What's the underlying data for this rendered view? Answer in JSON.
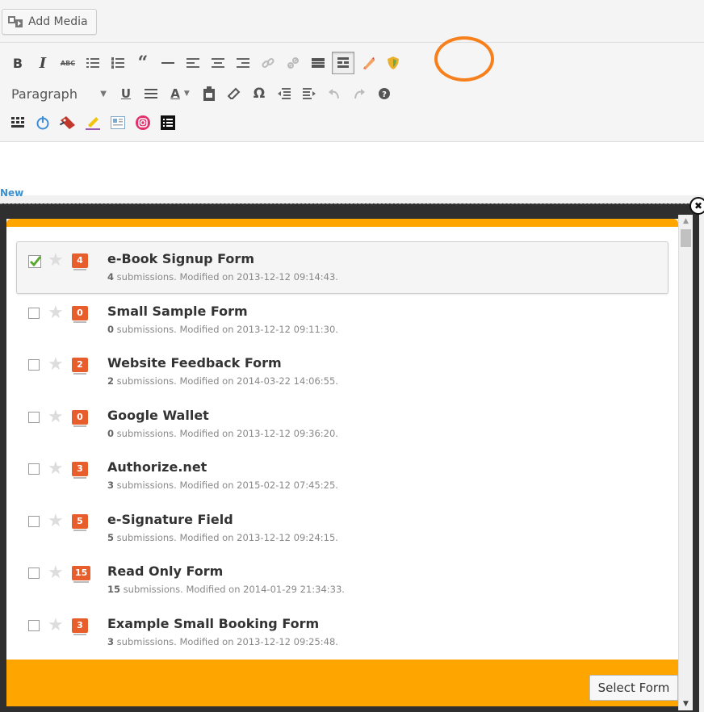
{
  "editor": {
    "add_media_label": "Add Media",
    "format_select_value": "Paragraph",
    "new_tag": "New"
  },
  "colors": {
    "accent_orange": "#ffa500",
    "highlight_ring": "#f7801c",
    "badge_red": "#e75e2c",
    "check_green": "#5aa832"
  },
  "toolbar": {
    "row1": [
      "bold-icon",
      "italic-icon",
      "strikethrough-icon",
      "bullet-list-icon",
      "numbered-list-icon",
      "blockquote-icon",
      "horizontal-rule-icon",
      "align-left-icon",
      "align-center-icon",
      "align-right-icon",
      "link-icon",
      "unlink-icon",
      "read-more-icon",
      "toolbar-toggle-icon",
      "form-pen-icon",
      "shield-icon"
    ],
    "row2": [
      "underline-icon",
      "justify-icon",
      "text-color-icon",
      "paste-text-icon",
      "clear-format-icon",
      "special-char-icon",
      "outdent-icon",
      "indent-icon",
      "undo-icon",
      "redo-icon",
      "help-icon"
    ],
    "row3": [
      "grid-icon",
      "power-icon",
      "tag-icon",
      "marker-icon",
      "image-text-icon",
      "instagram-icon",
      "list-block-icon"
    ]
  },
  "modal": {
    "select_button_label": "Select Form",
    "forms": [
      {
        "title": "e-Book Signup Form",
        "count": "4",
        "meta_count": "4",
        "meta": " submissions. Modified on 2013-12-12 09:14:43.",
        "selected": true
      },
      {
        "title": "Small Sample Form",
        "count": "0",
        "meta_count": "0",
        "meta": " submissions. Modified on 2013-12-12 09:11:30.",
        "selected": false
      },
      {
        "title": "Website Feedback Form",
        "count": "2",
        "meta_count": "2",
        "meta": " submissions. Modified on 2014-03-22 14:06:55.",
        "selected": false
      },
      {
        "title": "Google Wallet",
        "count": "0",
        "meta_count": "0",
        "meta": " submissions. Modified on 2013-12-12 09:36:20.",
        "selected": false
      },
      {
        "title": "Authorize.net",
        "count": "3",
        "meta_count": "3",
        "meta": " submissions. Modified on 2015-02-12 07:45:25.",
        "selected": false
      },
      {
        "title": "e-Signature Field",
        "count": "5",
        "meta_count": "5",
        "meta": " submissions. Modified on 2013-12-12 09:24:15.",
        "selected": false
      },
      {
        "title": "Read Only Form",
        "count": "15",
        "meta_count": "15",
        "meta": " submissions. Modified on 2014-01-29 21:34:33.",
        "selected": false
      },
      {
        "title": "Example Small Booking Form",
        "count": "3",
        "meta_count": "3",
        "meta": " submissions. Modified on 2013-12-12 09:25:48.",
        "selected": false
      }
    ]
  }
}
